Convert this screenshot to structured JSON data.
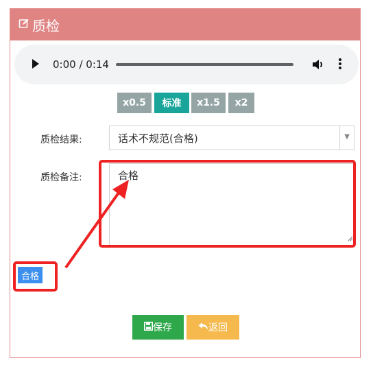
{
  "header": {
    "title": "质检",
    "icon": "edit-icon"
  },
  "audio": {
    "time": "0:00 / 0:14",
    "progress": 0
  },
  "speed_buttons": [
    {
      "label": "x0.5",
      "color": "#95a5a6"
    },
    {
      "label": "标准",
      "color": "#1aa59a"
    },
    {
      "label": "x1.5",
      "color": "#95a5a6"
    },
    {
      "label": "x2",
      "color": "#95a5a6"
    }
  ],
  "form": {
    "result_label": "质检结果:",
    "result_value": "话术不规范(合格)",
    "remark_label": "质检备注:",
    "remark_value": "合格"
  },
  "tag": {
    "label": "合格",
    "color": "#3b8fee"
  },
  "buttons": {
    "save": {
      "label": "保存",
      "color": "#2ea84a"
    },
    "back": {
      "label": "返回",
      "color": "#f5b94d"
    }
  },
  "annotation_color": "#ee2222"
}
